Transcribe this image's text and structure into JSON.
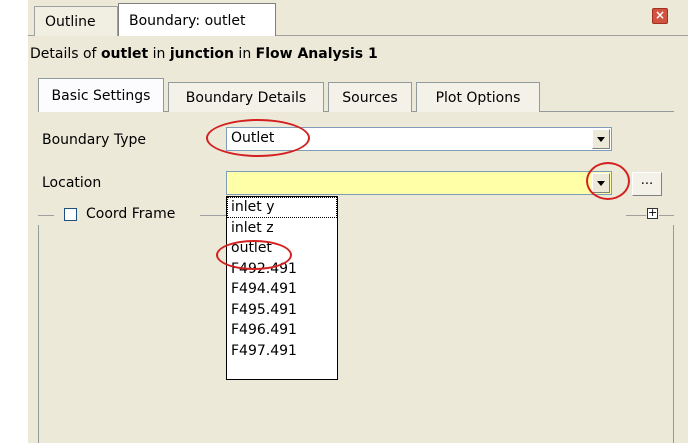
{
  "tabs": {
    "outline": "Outline",
    "boundary": "Boundary: outlet"
  },
  "icons": {
    "close": "close-icon"
  },
  "details": {
    "prefix": "Details of ",
    "object": "outlet",
    "mid1": " in ",
    "domain": "junction",
    "mid2": " in ",
    "analysis": "Flow Analysis 1"
  },
  "sub_tabs": [
    {
      "label": "Basic Settings",
      "active": true
    },
    {
      "label": "Boundary Details",
      "active": false
    },
    {
      "label": "Sources",
      "active": false
    },
    {
      "label": "Plot Options",
      "active": false
    }
  ],
  "form": {
    "boundary_type_label": "Boundary Type",
    "boundary_type_value": "Outlet",
    "location_label": "Location",
    "location_value": "",
    "dots_label": "...",
    "coord_frame_label": "Coord Frame",
    "coord_frame_checked": false,
    "expand_symbol": "+"
  },
  "location_options": [
    "inlet y",
    "inlet z",
    "outlet",
    "F492.491",
    "F494.491",
    "F495.491",
    "F496.491",
    "F497.491"
  ],
  "colors": {
    "panel_bg": "#ece9d8",
    "location_bg": "#ffffa8",
    "annotation_red": "#d42020"
  }
}
